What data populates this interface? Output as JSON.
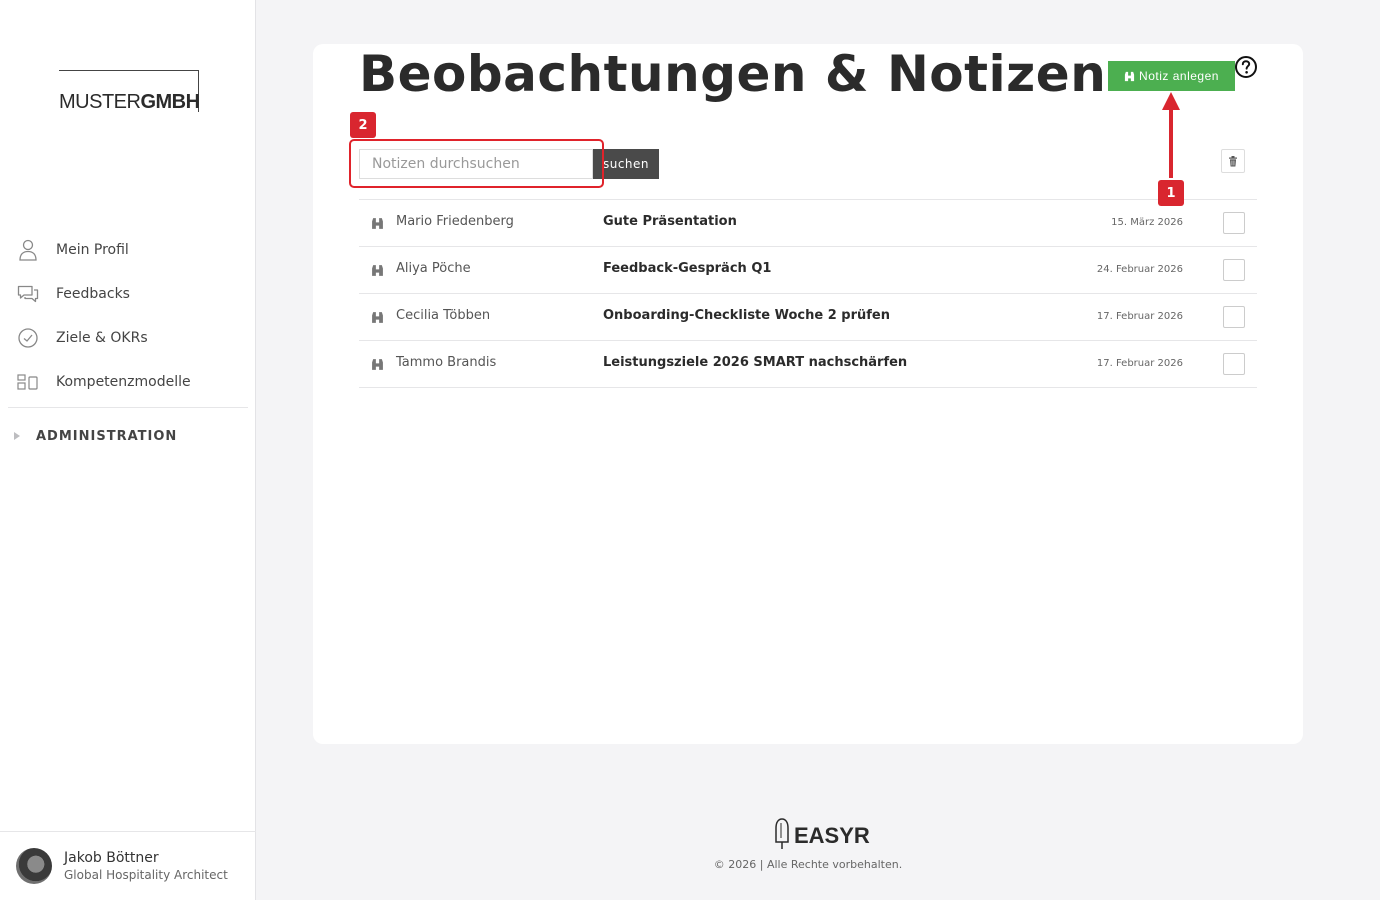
{
  "sidebar": {
    "logo": {
      "part1": "MUSTER",
      "part2": "GMBH"
    },
    "items": [
      {
        "label": "Mein Profil",
        "icon": "user-icon"
      },
      {
        "label": "Feedbacks",
        "icon": "chat-icon"
      },
      {
        "label": "Ziele & OKRs",
        "icon": "check-circle-icon"
      },
      {
        "label": "Kompetenzmodelle",
        "icon": "blocks-icon"
      }
    ],
    "admin_label": "ADMINISTRATION",
    "user": {
      "name": "Jakob Böttner",
      "role": "Global Hospitality Architect"
    }
  },
  "main": {
    "title": "Beobachtungen & Notizen",
    "new_note_label": "Notiz anlegen",
    "search": {
      "placeholder": "Notizen durchsuchen",
      "button_label": "suchen"
    },
    "notes": [
      {
        "person": "Mario Friedenberg",
        "subject": "Gute Präsentation",
        "date": "15. März 2026"
      },
      {
        "person": "Aliya Pöche",
        "subject": "Feedback-Gespräch Q1",
        "date": "24. Februar 2026"
      },
      {
        "person": "Cecilia Többen",
        "subject": "Onboarding-Checkliste Woche 2 prüfen",
        "date": "17. Februar 2026"
      },
      {
        "person": "Tammo Brandis",
        "subject": "Leistungsziele 2026 SMART nachschärfen",
        "date": "17. Februar 2026"
      }
    ]
  },
  "annotations": {
    "badge1": "1",
    "badge2": "2",
    "color": "#d9262f"
  },
  "footer": {
    "brand": "EASYR",
    "copyright": "© 2026 | Alle Rechte vorbehalten."
  },
  "colors": {
    "accent_green": "#4caf50",
    "dark_button": "#4a4a4a"
  }
}
